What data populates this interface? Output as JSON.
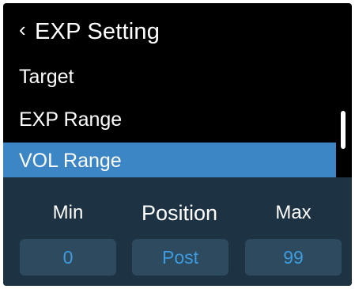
{
  "header": {
    "back_icon": "‹",
    "title": "EXP Setting"
  },
  "menu": {
    "items": [
      {
        "label": "Target",
        "selected": false
      },
      {
        "label": "EXP Range",
        "selected": false
      },
      {
        "label": "VOL Range",
        "selected": true
      }
    ]
  },
  "panel": {
    "min": {
      "label": "Min",
      "value": "0"
    },
    "position": {
      "label": "Position",
      "value": "Post"
    },
    "max": {
      "label": "Max",
      "value": "99"
    }
  },
  "colors": {
    "background": "#000000",
    "selected_row": "#3d86c6",
    "panel_bg": "#1d3242",
    "value_box_bg": "#2e4a5e",
    "value_text": "#3d9be0"
  }
}
